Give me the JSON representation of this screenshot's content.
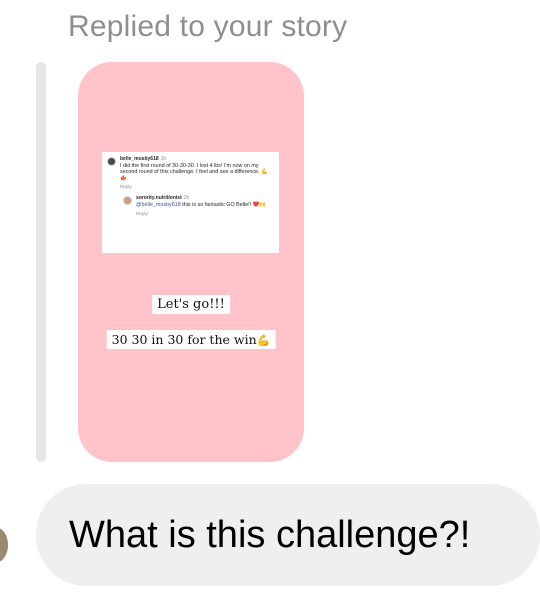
{
  "reply_header": "Replied to your story",
  "story": {
    "comments": [
      {
        "username": "belle_mosby618",
        "time": "1h",
        "text": "I did the first round of 30-30-30. I lost 4 lbs! I'm now on my second round of this challenge. I feel and see a difference. 💪🍁",
        "reply_label": "Reply"
      },
      {
        "username": "sorority.nutritionist",
        "time": "2h",
        "mention": "@belle_mosby618",
        "text": "this is so fantastic GO Belle!! ❤️🙌",
        "reply_label": "Reply"
      }
    ],
    "caption_1": "Let's go!!!",
    "caption_2": "30 30 in 30 for the win",
    "caption_2_emoji": "💪"
  },
  "message": {
    "text": "What is this challenge?!"
  }
}
